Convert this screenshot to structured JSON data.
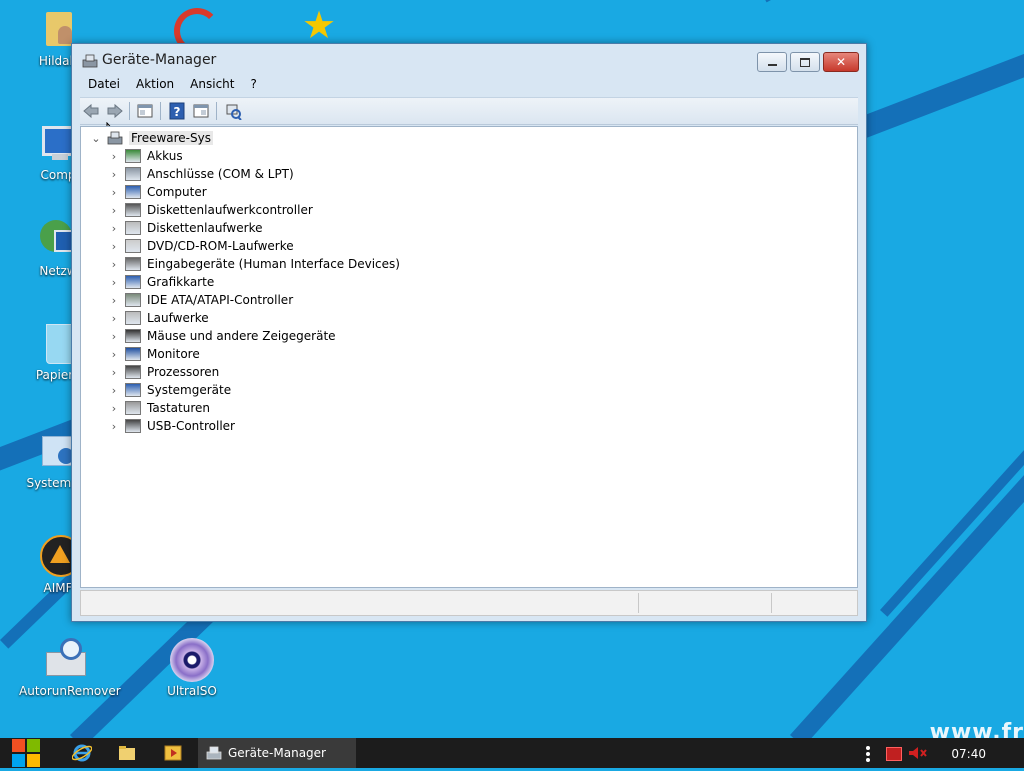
{
  "desktop": {
    "icons": [
      {
        "label": "Hildab",
        "icon": "folder-user-icon"
      },
      {
        "label": "Comp",
        "icon": "computer-icon"
      },
      {
        "label": "Netzw",
        "icon": "network-icon"
      },
      {
        "label": "Papierk",
        "icon": "recycle-bin-icon"
      },
      {
        "label": "Systemste",
        "icon": "control-panel-icon"
      },
      {
        "label": "AIMF",
        "icon": "aimp-icon"
      },
      {
        "label": "AutorunRemover",
        "icon": "autorun-remover-icon"
      },
      {
        "label": "UltraISO",
        "icon": "disc-icon"
      }
    ],
    "watermark": "www.fr"
  },
  "window": {
    "title": "Geräte-Manager",
    "menu": [
      "Datei",
      "Aktion",
      "Ansicht",
      "?"
    ],
    "toolbar_icons": [
      "back-icon",
      "forward-icon",
      "properties-icon",
      "help-icon",
      "view-icon",
      "scan-hardware-icon"
    ],
    "tree": {
      "root": "Freeware-Sys",
      "items": [
        {
          "label": "Akkus",
          "icon": "battery-icon"
        },
        {
          "label": "Anschlüsse (COM & LPT)",
          "icon": "port-icon"
        },
        {
          "label": "Computer",
          "icon": "computer-icon"
        },
        {
          "label": "Diskettenlaufwerkcontroller",
          "icon": "floppy-controller-icon"
        },
        {
          "label": "Diskettenlaufwerke",
          "icon": "floppy-drive-icon"
        },
        {
          "label": "DVD/CD-ROM-Laufwerke",
          "icon": "dvd-drive-icon"
        },
        {
          "label": "Eingabegeräte (Human Interface Devices)",
          "icon": "hid-icon"
        },
        {
          "label": "Grafikkarte",
          "icon": "display-adapter-icon"
        },
        {
          "label": "IDE ATA/ATAPI-Controller",
          "icon": "ide-controller-icon"
        },
        {
          "label": "Laufwerke",
          "icon": "disk-drive-icon"
        },
        {
          "label": "Mäuse und andere Zeigegeräte",
          "icon": "mouse-icon"
        },
        {
          "label": "Monitore",
          "icon": "monitor-icon"
        },
        {
          "label": "Prozessoren",
          "icon": "processor-icon"
        },
        {
          "label": "Systemgeräte",
          "icon": "system-device-icon"
        },
        {
          "label": "Tastaturen",
          "icon": "keyboard-icon"
        },
        {
          "label": "USB-Controller",
          "icon": "usb-icon"
        }
      ]
    }
  },
  "taskbar": {
    "active_task": "Geräte-Manager",
    "clock": "07:40",
    "pinned_icons": [
      "start-icon",
      "internet-explorer-icon",
      "explorer-icon",
      "media-player-icon"
    ]
  }
}
